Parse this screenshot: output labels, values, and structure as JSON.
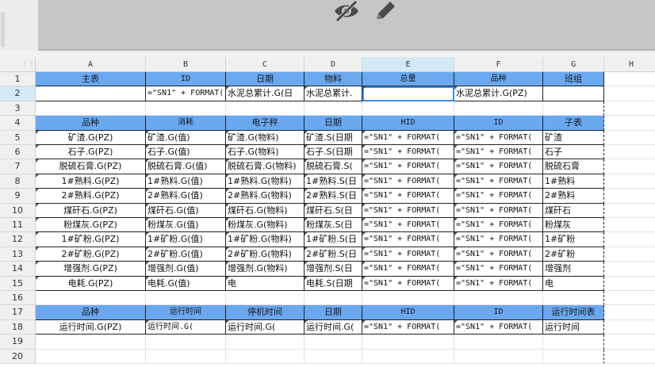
{
  "toolbar": {
    "buttons": [
      {
        "name": "hide-button",
        "icon": "eye-slash-icon"
      },
      {
        "name": "edit-button",
        "icon": "pencil-icon"
      }
    ]
  },
  "columns": [
    "A",
    "B",
    "C",
    "D",
    "E",
    "F",
    "G",
    "H"
  ],
  "rows": [
    "1",
    "2",
    "3",
    "4",
    "5",
    "6",
    "7",
    "8",
    "9",
    "10",
    "11",
    "12",
    "13",
    "14",
    "15",
    "16",
    "17",
    "18",
    "19",
    "20"
  ],
  "selected": {
    "column": "E",
    "row": "2"
  },
  "colors": {
    "header_fill": "#6aa8f0",
    "selection": "#3d8ee6"
  },
  "cells": {
    "r1": [
      "主表",
      "ID",
      "日期",
      "物料",
      "总量",
      "品种",
      "班组"
    ],
    "r2": [
      "",
      "=\"SN1\" + FORMAT(",
      "水泥总累计.G(日",
      "水泥总累计.",
      "",
      "水泥总累计.G(PZ)",
      ""
    ],
    "r4": [
      "品种",
      "消耗",
      "电子秤",
      "日期",
      "HID",
      "ID",
      "子表"
    ],
    "body": [
      [
        "矿渣.G(PZ)",
        "矿渣.G(值)",
        "矿渣.G(物料)",
        "矿渣.S(日期",
        "=\"SN1\" + FORMAT(",
        "=\"SN1\" + FORMAT(",
        "矿渣"
      ],
      [
        "石子.G(PZ)",
        "石子.G(值)",
        "石子.G(物料)",
        "石子.S(日期",
        "=\"SN1\" + FORMAT(",
        "=\"SN1\" + FORMAT(",
        "石子"
      ],
      [
        "脱硫石膏.G(PZ)",
        "脱硫石膏.G(值)",
        "脱硫石膏.G(物料)",
        "脱硫石膏.S(",
        "=\"SN1\" + FORMAT(",
        "=\"SN1\" + FORMAT(",
        "脱硫石膏"
      ],
      [
        "1#熟料.G(PZ)",
        "1#熟料.G(值)",
        "1#熟料.G(物料)",
        "1#熟料.S(日",
        "=\"SN1\" + FORMAT(",
        "=\"SN1\" + FORMAT(",
        "1#熟料"
      ],
      [
        "2#熟料.G(PZ)",
        "2#熟料.G(值)",
        "2#熟料.G(物料)",
        "2#熟料.S(日",
        "=\"SN1\" + FORMAT(",
        "=\"SN1\" + FORMAT(",
        "2#熟料"
      ],
      [
        "煤矸石.G(PZ)",
        "煤矸石.G(值)",
        "煤矸石.G(物料)",
        "煤矸石.S(日",
        "=\"SN1\" + FORMAT(",
        "=\"SN1\" + FORMAT(",
        "煤矸石"
      ],
      [
        "粉煤灰.G(PZ)",
        "粉煤灰.G(值)",
        "粉煤灰.G(物料)",
        "粉煤灰.S(日",
        "=\"SN1\" + FORMAT(",
        "=\"SN1\" + FORMAT(",
        "粉煤灰"
      ],
      [
        "1#矿粉.G(PZ)",
        "1#矿粉.G(值)",
        "1#矿粉.G(物料)",
        "1#矿粉.S(日",
        "=\"SN1\" + FORMAT(",
        "=\"SN1\" + FORMAT(",
        "1#矿粉"
      ],
      [
        "2#矿粉.G(PZ)",
        "2#矿粉.G(值)",
        "2#矿粉.G(物料)",
        "2#矿粉.S(日",
        "=\"SN1\" + FORMAT(",
        "=\"SN1\" + FORMAT(",
        "2#矿粉"
      ],
      [
        "增强剂.G(PZ)",
        "增强剂.G(值)",
        "增强剂.G(物料)",
        "增强剂.S(日",
        "=\"SN1\" + FORMAT(",
        "=\"SN1\" + FORMAT(",
        "增强剂"
      ],
      [
        "电耗.G(PZ)",
        "电耗.G(值)",
        "电",
        "电耗.S(日期",
        "=\"SN1\" + FORMAT(",
        "=\"SN1\" + FORMAT(",
        "电"
      ]
    ],
    "r17": [
      "品种",
      "运行时间",
      "停机时间",
      "日期",
      "HID",
      "ID",
      "运行时间表"
    ],
    "r18": [
      "运行时间.G(PZ)",
      "运行时间.G(",
      "运行时间.G(",
      "运行时间.G(",
      "=\"SN1\" + FORMAT(",
      "=\"SN1\" + FORMAT(",
      "运行时间"
    ]
  }
}
